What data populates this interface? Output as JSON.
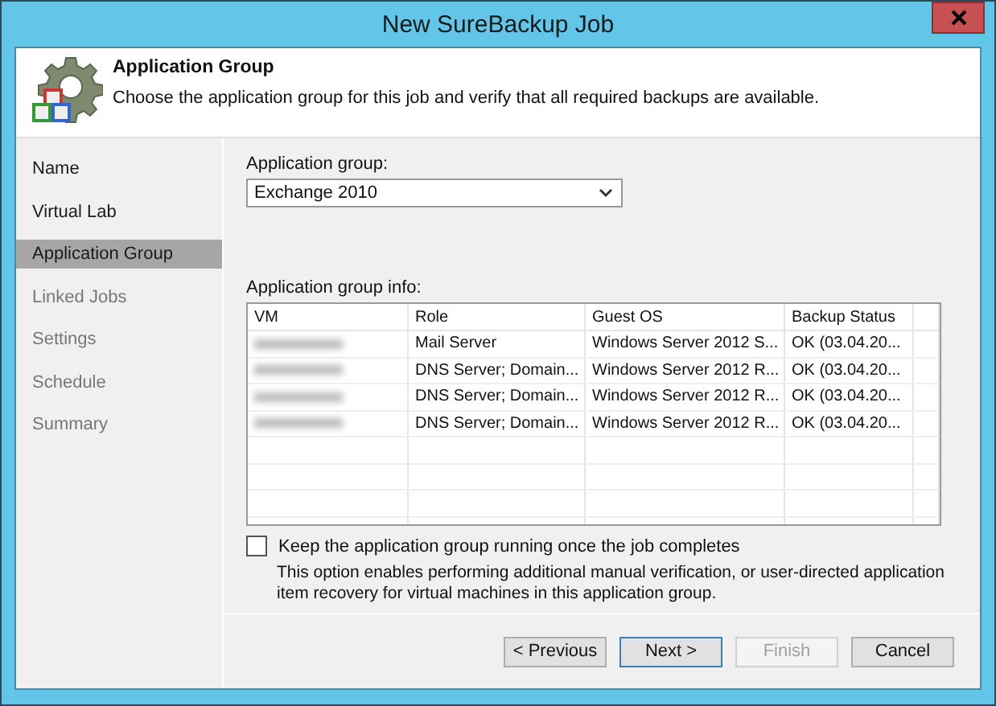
{
  "window": {
    "title": "New SureBackup Job"
  },
  "header": {
    "title": "Application Group",
    "description": "Choose the application group for this job and verify that all required backups are available."
  },
  "sidebar": {
    "items": [
      {
        "label": "Name",
        "selected": false,
        "disabled": false
      },
      {
        "label": "Virtual Lab",
        "selected": false,
        "disabled": false
      },
      {
        "label": "Application Group",
        "selected": true,
        "disabled": false
      },
      {
        "label": "Linked Jobs",
        "selected": false,
        "disabled": true
      },
      {
        "label": "Settings",
        "selected": false,
        "disabled": true
      },
      {
        "label": "Schedule",
        "selected": false,
        "disabled": true
      },
      {
        "label": "Summary",
        "selected": false,
        "disabled": true
      }
    ]
  },
  "application_group": {
    "label": "Application group:",
    "value": "Exchange 2010"
  },
  "info": {
    "label": "Application group info:",
    "columns": [
      "VM",
      "Role",
      "Guest OS",
      "Backup Status"
    ],
    "rows": [
      {
        "role": "Mail Server",
        "guest_os": "Windows Server 2012 S...",
        "backup_status": "OK (03.04.20..."
      },
      {
        "role": "DNS Server; Domain...",
        "guest_os": "Windows Server 2012 R...",
        "backup_status": "OK (03.04.20..."
      },
      {
        "role": "DNS Server; Domain...",
        "guest_os": "Windows Server 2012 R...",
        "backup_status": "OK (03.04.20..."
      },
      {
        "role": "DNS Server; Domain...",
        "guest_os": "Windows Server 2012 R...",
        "backup_status": "OK (03.04.20..."
      }
    ]
  },
  "keep_running": {
    "label": "Keep the application group running once the job completes",
    "checked": false,
    "description": "This option enables performing additional manual verification, or user-directed application item recovery for virtual machines in this application group."
  },
  "buttons": [
    {
      "label": "< Previous",
      "disabled": false,
      "default": false
    },
    {
      "label": "Next >",
      "disabled": false,
      "default": true
    },
    {
      "label": "Finish",
      "disabled": true,
      "default": false
    },
    {
      "label": "Cancel",
      "disabled": false,
      "default": false
    }
  ]
}
